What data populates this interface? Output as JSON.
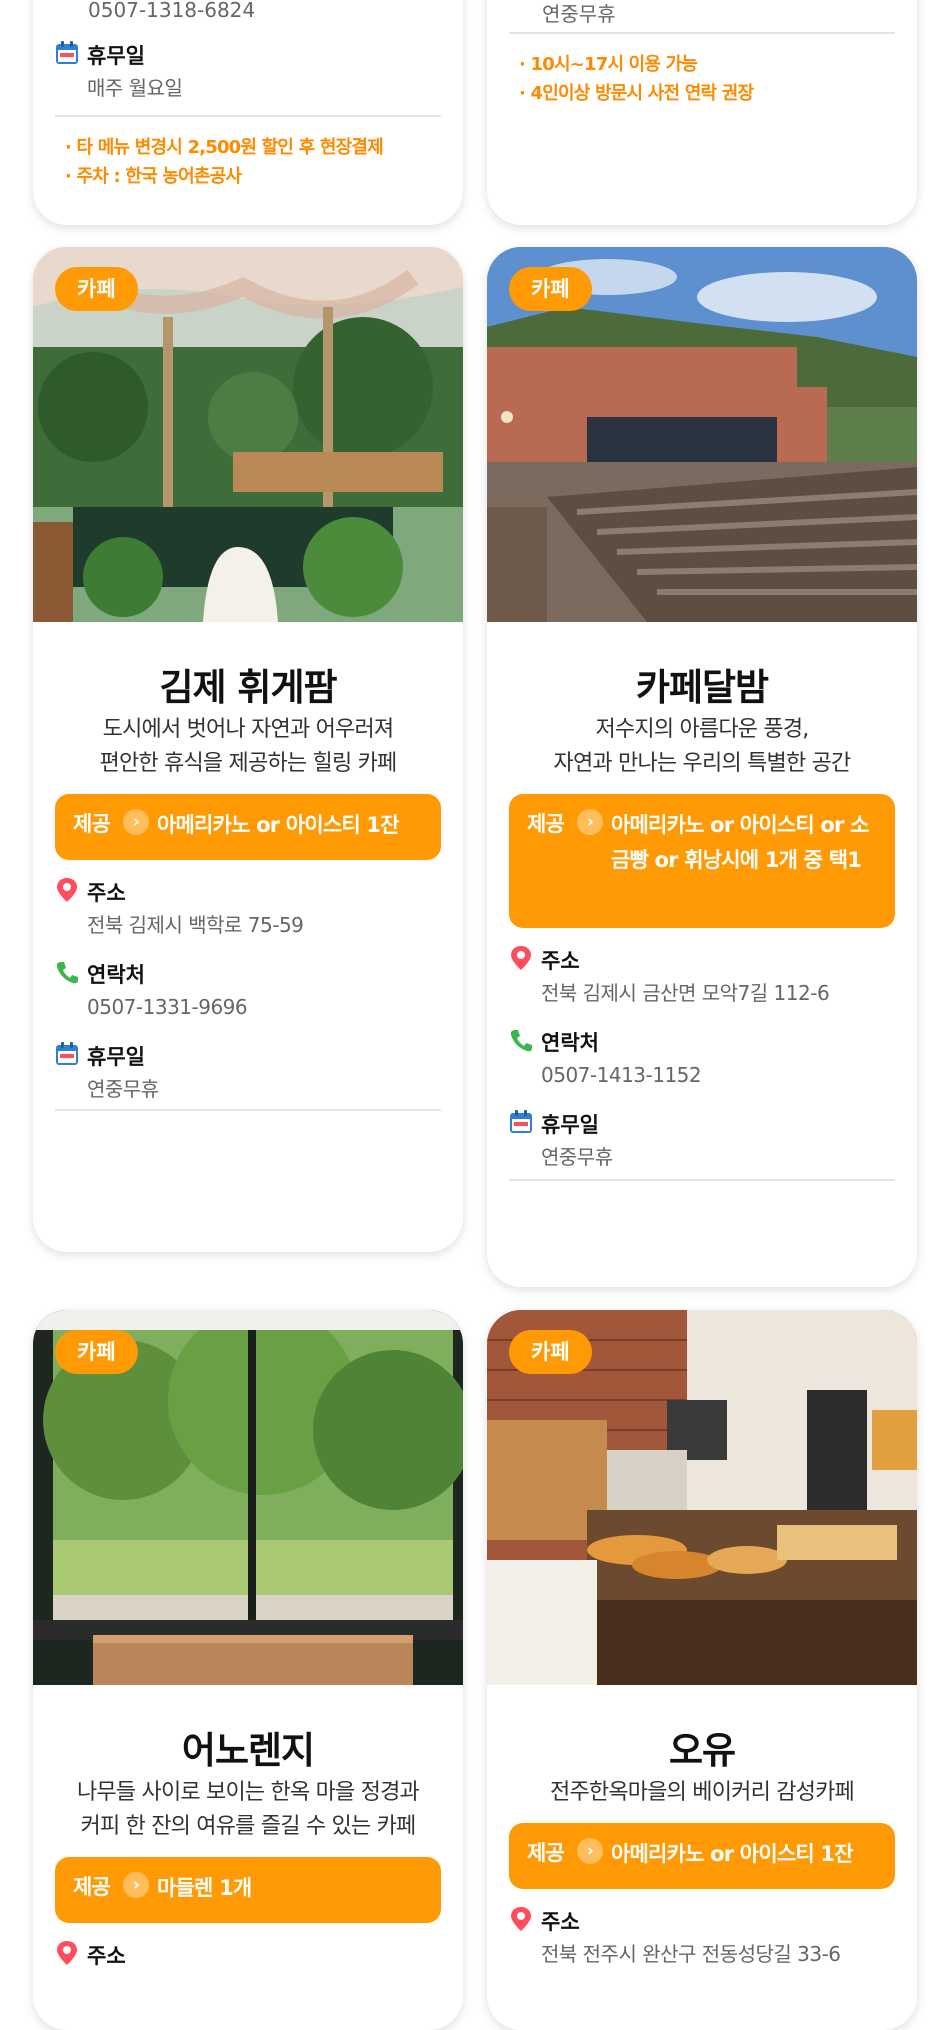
{
  "top_left": {
    "phone_partial": "0507-1318-6824",
    "holiday_label": "휴무일",
    "holiday_value": "매주 월요일",
    "notes": [
      "· 타 메뉴 변경시 2,500원 할인 후 현장결제",
      "· 주차 : 한국 농어촌공사"
    ]
  },
  "top_right": {
    "holiday_partial": "연중무휴",
    "notes": [
      "· 10시~17시 이용 가능",
      "· 4인이상 방문시 사전 연락 권장"
    ]
  },
  "labels": {
    "badge": "카페",
    "offer": "제공",
    "address": "주소",
    "contact": "연락처",
    "holiday": "휴무일"
  },
  "cards": [
    {
      "name": "김제 휘게팜",
      "desc": [
        "도시에서 벗어나 자연과 어우러져",
        "편안한 휴식을 제공하는 힐링 카페"
      ],
      "offer": "아메리카노 or 아이스티 1잔",
      "address": "전북 김제시 백학로 75-59",
      "contact": "0507-1331-9696",
      "holiday": "연중무휴"
    },
    {
      "name": "카페달밤",
      "desc": [
        "저수지의 아름다운 풍경,",
        "자연과 만나는 우리의 특별한 공간"
      ],
      "offer": "아메리카노 or 아이스티 or 소금빵 or 휘낭시에 1개 중 택1",
      "address": "전북 김제시 금산면 모악7길 112-6",
      "contact": "0507-1413-1152",
      "holiday": "연중무휴"
    },
    {
      "name": "어노렌지",
      "desc": [
        "나무들 사이로 보이는 한옥 마을 정경과",
        "커피 한 잔의 여유를 즐길 수 있는 카페"
      ],
      "offer": "마들렌 1개"
    },
    {
      "name": "오유",
      "desc": [
        "전주한옥마을의 베이커리 감성카페"
      ],
      "offer": "아메리카노 or 아이스티 1잔",
      "address": "전북 전주시 완산구 전동성당길 33-6"
    }
  ],
  "colors": {
    "accent": "#ff9a05",
    "note": "#ff8a00",
    "pin": "#ff4d5e",
    "phone": "#3cb54a",
    "calendar": "#2f7fd6"
  }
}
